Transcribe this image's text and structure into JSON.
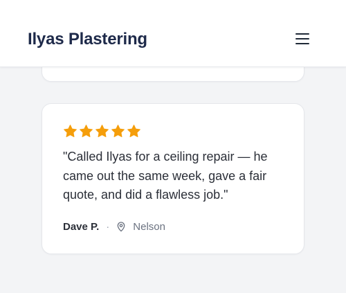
{
  "header": {
    "brand": "Ilyas Plastering",
    "menu_icon": "hamburger-menu-icon"
  },
  "review": {
    "rating": 5,
    "rating_max": 5,
    "star_color": "#f59e0b",
    "quote": "\"Called Ilyas for a ceiling repair — he came out the same week, gave a fair quote, and did a flawless job.\"",
    "author": "Dave P.",
    "separator": "·",
    "location_icon": "location-pin-icon",
    "location": "Nelson"
  },
  "colors": {
    "brand_text": "#1e2a4a",
    "background": "#f3f4f6"
  }
}
